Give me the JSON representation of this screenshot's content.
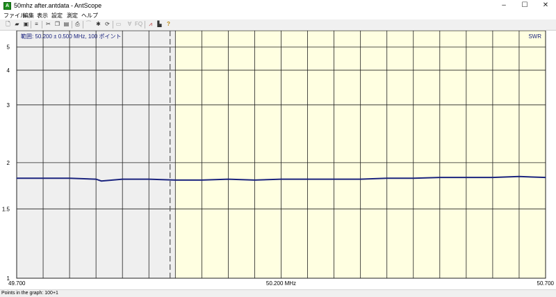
{
  "window": {
    "title": "50mhz after.antdata - AntScope",
    "icon_name": "antscope-app-icon",
    "controls": [
      "–",
      "☐",
      "✕"
    ]
  },
  "menu": {
    "items": [
      "ファイル",
      "編集",
      "表示",
      "設定",
      "測定",
      "ヘルプ"
    ]
  },
  "toolbar": {
    "buttons": [
      {
        "name": "new-file-icon",
        "glyph": "🗋",
        "enabled": true
      },
      {
        "name": "open-folder-icon",
        "glyph": "▰",
        "enabled": true
      },
      {
        "name": "save-icon",
        "glyph": "▣",
        "enabled": true
      },
      {
        "name": "properties-icon",
        "glyph": "≡",
        "enabled": true
      },
      {
        "name": "cut-icon",
        "glyph": "✂",
        "enabled": true
      },
      {
        "name": "copy-icon",
        "glyph": "❐",
        "enabled": true
      },
      {
        "name": "paste-icon",
        "glyph": "▤",
        "enabled": true
      },
      {
        "name": "print-icon",
        "glyph": "⎙",
        "enabled": true
      },
      {
        "name": "smooth-icon",
        "glyph": "⁀",
        "enabled": false
      },
      {
        "name": "scan-icon",
        "glyph": "✱",
        "enabled": true
      },
      {
        "name": "refresh-icon",
        "glyph": "⟳",
        "enabled": true
      },
      {
        "name": "range-icon",
        "glyph": "▭",
        "enabled": false
      },
      {
        "name": "filter-icon",
        "glyph": "∀",
        "enabled": false
      },
      {
        "name": "find-icon",
        "glyph": "FQ",
        "enabled": false
      },
      {
        "name": "swr-graph-icon",
        "glyph": "⩘",
        "enabled": true
      },
      {
        "name": "chart-icon",
        "glyph": "▙",
        "enabled": true
      },
      {
        "name": "help-icon",
        "glyph": "?",
        "enabled": true
      }
    ]
  },
  "graph": {
    "range_text": "範囲: 50.200 ± 0.500 MHz, 100 ポイント",
    "parameter_label": "SWR",
    "colors": {
      "outside_band": "#efefef",
      "in_band": "#ffffe1",
      "grid": "#202020",
      "trace": "#1a237e",
      "marker": "#555555"
    }
  },
  "chart_data": {
    "type": "line",
    "title": "",
    "xlabel": "",
    "ylabel": "SWR",
    "xlim": [
      49.7,
      50.7
    ],
    "ylim": [
      1,
      6
    ],
    "y_scale": "swr",
    "x_tick_labels": [
      {
        "value": 49.7,
        "label": "49.700"
      },
      {
        "value": 50.2,
        "label": "50.200 MHz"
      },
      {
        "value": 50.7,
        "label": "50.700"
      }
    ],
    "x_gridlines": [
      49.7,
      49.75,
      49.8,
      49.85,
      49.9,
      49.95,
      50.0,
      50.05,
      50.1,
      50.15,
      50.2,
      50.25,
      50.3,
      50.35,
      50.4,
      50.45,
      50.5,
      50.55,
      50.6,
      50.65,
      50.7
    ],
    "y_ticks": [
      {
        "value": 1,
        "label": "1"
      },
      {
        "value": 1.5,
        "label": "1.5"
      },
      {
        "value": 2,
        "label": "2"
      },
      {
        "value": 3,
        "label": "3"
      },
      {
        "value": 4,
        "label": "4"
      },
      {
        "value": 5,
        "label": "5"
      }
    ],
    "band_start_mhz": 50.0,
    "marker_mhz": 49.99,
    "series": [
      {
        "x": [
          49.7,
          49.75,
          49.8,
          49.85,
          49.86,
          49.9,
          49.95,
          50.0,
          50.05,
          50.1,
          50.15,
          50.2,
          50.25,
          50.3,
          50.35,
          50.4,
          50.45,
          50.5,
          50.55,
          50.6,
          50.65,
          50.7
        ],
        "values": [
          1.81,
          1.81,
          1.81,
          1.8,
          1.78,
          1.8,
          1.8,
          1.79,
          1.79,
          1.8,
          1.79,
          1.8,
          1.8,
          1.8,
          1.8,
          1.81,
          1.81,
          1.82,
          1.82,
          1.82,
          1.83,
          1.82
        ]
      }
    ]
  },
  "status": {
    "text": "Points in the graph: 100+1"
  }
}
